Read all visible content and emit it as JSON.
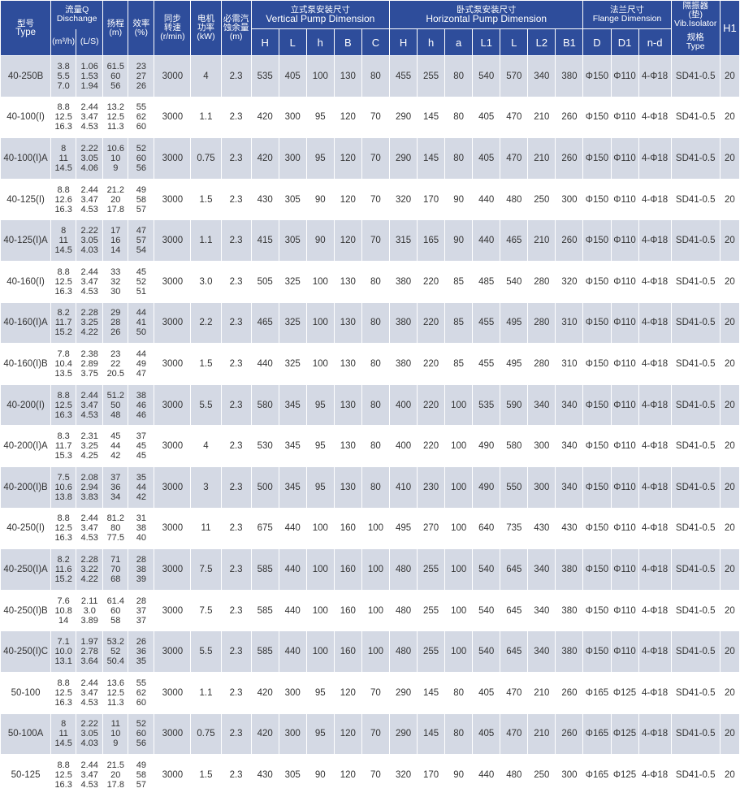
{
  "header": {
    "type_cn": "型号",
    "type_en": "Type",
    "flow_cn": "流量Q",
    "flow_en": "Dischange",
    "flow_unit_m3h": "(m³/h)",
    "flow_unit_ls": "(L/S)",
    "head_cn": "扬程",
    "head_unit": "(m)",
    "eff_cn": "效率",
    "eff_unit": "(%)",
    "speed_cn1": "同步",
    "speed_cn2": "转速",
    "speed_unit": "(r/min)",
    "power_cn1": "电机",
    "power_cn2": "功率",
    "power_unit": "(kW)",
    "npsh_cn1": "必需汽",
    "npsh_cn2": "蚀余量",
    "npsh_unit": "(m)",
    "vertical_cn": "立式泵安装尺寸",
    "vertical_en": "Vertical  Pump  Dimension",
    "horizontal_cn": "卧式泵安装尺寸",
    "horizontal_en": "Horizontal Pump Dimension",
    "flange_cn": "法兰尺寸",
    "flange_en": "Flange Dimension",
    "iso_cn1": "隔振器",
    "iso_cn2": "(垫)",
    "iso_en": "Vib.Isolator",
    "iso_sub_cn": "规格",
    "iso_sub_en": "Type",
    "h1": "H1",
    "v_cols": [
      "H",
      "L",
      "h",
      "B",
      "C"
    ],
    "h_cols": [
      "H",
      "h",
      "a",
      "L1",
      "L",
      "L2",
      "B1"
    ],
    "f_cols": [
      "D",
      "D1",
      "n-d"
    ]
  },
  "rows": [
    {
      "type": "40-250B",
      "q": [
        "3.8",
        "5.5",
        "7.0"
      ],
      "ls": [
        "1.06",
        "1.53",
        "1.94"
      ],
      "head": [
        "61.5",
        "60",
        "56"
      ],
      "eff": [
        "23",
        "27",
        "26"
      ],
      "speed": "3000",
      "power": "4",
      "npsh": "2.3",
      "v": [
        "535",
        "405",
        "100",
        "130",
        "80"
      ],
      "h": [
        "455",
        "255",
        "80",
        "540",
        "570",
        "340",
        "380"
      ],
      "f": [
        "Φ150",
        "Φ110",
        "4-Φ18"
      ],
      "iso": "SD41-0.5",
      "h1": "20"
    },
    {
      "type": "40-100(I)",
      "q": [
        "8.8",
        "12.5",
        "16.3"
      ],
      "ls": [
        "2.44",
        "3.47",
        "4.53"
      ],
      "head": [
        "13.2",
        "12.5",
        "11.3"
      ],
      "eff": [
        "55",
        "62",
        "60"
      ],
      "speed": "3000",
      "power": "1.1",
      "npsh": "2.3",
      "v": [
        "420",
        "300",
        "95",
        "120",
        "70"
      ],
      "h": [
        "290",
        "145",
        "80",
        "405",
        "470",
        "210",
        "260"
      ],
      "f": [
        "Φ150",
        "Φ110",
        "4-Φ18"
      ],
      "iso": "SD41-0.5",
      "h1": "20"
    },
    {
      "type": "40-100(I)A",
      "q": [
        "8",
        "11",
        "14.5"
      ],
      "ls": [
        "2.22",
        "3.05",
        "4.06"
      ],
      "head": [
        "10.6",
        "10",
        "9"
      ],
      "eff": [
        "52",
        "60",
        "56"
      ],
      "speed": "3000",
      "power": "0.75",
      "npsh": "2.3",
      "v": [
        "420",
        "300",
        "95",
        "120",
        "70"
      ],
      "h": [
        "290",
        "145",
        "80",
        "405",
        "470",
        "210",
        "260"
      ],
      "f": [
        "Φ150",
        "Φ110",
        "4-Φ18"
      ],
      "iso": "SD41-0.5",
      "h1": "20"
    },
    {
      "type": "40-125(I)",
      "q": [
        "8.8",
        "12.6",
        "16.3"
      ],
      "ls": [
        "2.44",
        "3.47",
        "4.53"
      ],
      "head": [
        "21.2",
        "20",
        "17.8"
      ],
      "eff": [
        "49",
        "58",
        "57"
      ],
      "speed": "3000",
      "power": "1.5",
      "npsh": "2.3",
      "v": [
        "430",
        "305",
        "90",
        "120",
        "70"
      ],
      "h": [
        "320",
        "170",
        "90",
        "440",
        "480",
        "250",
        "300"
      ],
      "f": [
        "Φ150",
        "Φ110",
        "4-Φ18"
      ],
      "iso": "SD41-0.5",
      "h1": "20"
    },
    {
      "type": "40-125(I)A",
      "q": [
        "8",
        "11",
        "14.5"
      ],
      "ls": [
        "2.22",
        "3.05",
        "4.03"
      ],
      "head": [
        "17",
        "16",
        "14"
      ],
      "eff": [
        "47",
        "57",
        "54"
      ],
      "speed": "3000",
      "power": "1.1",
      "npsh": "2.3",
      "v": [
        "415",
        "305",
        "90",
        "120",
        "70"
      ],
      "h": [
        "315",
        "165",
        "90",
        "440",
        "465",
        "210",
        "260"
      ],
      "f": [
        "Φ150",
        "Φ110",
        "4-Φ18"
      ],
      "iso": "SD41-0.5",
      "h1": "20"
    },
    {
      "type": "40-160(I)",
      "q": [
        "8.8",
        "12.5",
        "16.3"
      ],
      "ls": [
        "2.44",
        "3.47",
        "4.53"
      ],
      "head": [
        "33",
        "32",
        "30"
      ],
      "eff": [
        "45",
        "52",
        "51"
      ],
      "speed": "3000",
      "power": "3.0",
      "npsh": "2.3",
      "v": [
        "505",
        "325",
        "100",
        "130",
        "80"
      ],
      "h": [
        "380",
        "220",
        "85",
        "485",
        "540",
        "280",
        "320"
      ],
      "f": [
        "Φ150",
        "Φ110",
        "4-Φ18"
      ],
      "iso": "SD41-0.5",
      "h1": "20"
    },
    {
      "type": "40-160(I)A",
      "q": [
        "8.2",
        "11.7",
        "15.2"
      ],
      "ls": [
        "2.28",
        "3.25",
        "4.22"
      ],
      "head": [
        "29",
        "28",
        "26"
      ],
      "eff": [
        "44",
        "41",
        "50"
      ],
      "speed": "3000",
      "power": "2.2",
      "npsh": "2.3",
      "v": [
        "465",
        "325",
        "100",
        "130",
        "80"
      ],
      "h": [
        "380",
        "220",
        "85",
        "455",
        "495",
        "280",
        "310"
      ],
      "f": [
        "Φ150",
        "Φ110",
        "4-Φ18"
      ],
      "iso": "SD41-0.5",
      "h1": "20"
    },
    {
      "type": "40-160(I)B",
      "q": [
        "7.8",
        "10.4",
        "13.5"
      ],
      "ls": [
        "2.38",
        "2.89",
        "3.75"
      ],
      "head": [
        "23",
        "22",
        "20.5"
      ],
      "eff": [
        "44",
        "49",
        "47"
      ],
      "speed": "3000",
      "power": "1.5",
      "npsh": "2.3",
      "v": [
        "440",
        "325",
        "100",
        "130",
        "80"
      ],
      "h": [
        "380",
        "220",
        "85",
        "455",
        "495",
        "280",
        "310"
      ],
      "f": [
        "Φ150",
        "Φ110",
        "4-Φ18"
      ],
      "iso": "SD41-0.5",
      "h1": "20"
    },
    {
      "type": "40-200(I)",
      "q": [
        "8.8",
        "12.5",
        "16.3"
      ],
      "ls": [
        "2.44",
        "3.47",
        "4.53"
      ],
      "head": [
        "51.2",
        "50",
        "48"
      ],
      "eff": [
        "38",
        "46",
        "46"
      ],
      "speed": "3000",
      "power": "5.5",
      "npsh": "2.3",
      "v": [
        "580",
        "345",
        "95",
        "130",
        "80"
      ],
      "h": [
        "400",
        "220",
        "100",
        "535",
        "590",
        "340",
        "340"
      ],
      "f": [
        "Φ150",
        "Φ110",
        "4-Φ18"
      ],
      "iso": "SD41-0.5",
      "h1": "20"
    },
    {
      "type": "40-200(I)A",
      "q": [
        "8.3",
        "11.7",
        "15.3"
      ],
      "ls": [
        "2.31",
        "3.25",
        "4.25"
      ],
      "head": [
        "45",
        "44",
        "42"
      ],
      "eff": [
        "37",
        "45",
        "45"
      ],
      "speed": "3000",
      "power": "4",
      "npsh": "2.3",
      "v": [
        "530",
        "345",
        "95",
        "130",
        "80"
      ],
      "h": [
        "400",
        "220",
        "100",
        "490",
        "580",
        "300",
        "340"
      ],
      "f": [
        "Φ150",
        "Φ110",
        "4-Φ18"
      ],
      "iso": "SD41-0.5",
      "h1": "20"
    },
    {
      "type": "40-200(I)B",
      "q": [
        "7.5",
        "10.6",
        "13.8"
      ],
      "ls": [
        "2.08",
        "2.94",
        "3.83"
      ],
      "head": [
        "37",
        "36",
        "34"
      ],
      "eff": [
        "35",
        "44",
        "42"
      ],
      "speed": "3000",
      "power": "3",
      "npsh": "2.3",
      "v": [
        "500",
        "345",
        "95",
        "130",
        "80"
      ],
      "h": [
        "410",
        "230",
        "100",
        "490",
        "550",
        "300",
        "340"
      ],
      "f": [
        "Φ150",
        "Φ110",
        "4-Φ18"
      ],
      "iso": "SD41-0.5",
      "h1": "20"
    },
    {
      "type": "40-250(I)",
      "q": [
        "8.8",
        "12.5",
        "16.3"
      ],
      "ls": [
        "2.44",
        "3.47",
        "4.53"
      ],
      "head": [
        "81.2",
        "80",
        "77.5"
      ],
      "eff": [
        "31",
        "38",
        "40"
      ],
      "speed": "3000",
      "power": "11",
      "npsh": "2.3",
      "v": [
        "675",
        "440",
        "100",
        "160",
        "100"
      ],
      "h": [
        "495",
        "270",
        "100",
        "640",
        "735",
        "430",
        "430"
      ],
      "f": [
        "Φ150",
        "Φ110",
        "4-Φ18"
      ],
      "iso": "SD41-0.5",
      "h1": "20"
    },
    {
      "type": "40-250(I)A",
      "q": [
        "8.2",
        "11.6",
        "15.2"
      ],
      "ls": [
        "2.28",
        "3.22",
        "4.22"
      ],
      "head": [
        "71",
        "70",
        "68"
      ],
      "eff": [
        "28",
        "38",
        "39"
      ],
      "speed": "3000",
      "power": "7.5",
      "npsh": "2.3",
      "v": [
        "585",
        "440",
        "100",
        "160",
        "100"
      ],
      "h": [
        "480",
        "255",
        "100",
        "540",
        "645",
        "340",
        "380"
      ],
      "f": [
        "Φ150",
        "Φ110",
        "4-Φ18"
      ],
      "iso": "SD41-0.5",
      "h1": "20"
    },
    {
      "type": "40-250(I)B",
      "q": [
        "7.6",
        "10.8",
        "14"
      ],
      "ls": [
        "2.11",
        "3.0",
        "3.89"
      ],
      "head": [
        "61.4",
        "60",
        "58"
      ],
      "eff": [
        "28",
        "37",
        "37"
      ],
      "speed": "3000",
      "power": "7.5",
      "npsh": "2.3",
      "v": [
        "585",
        "440",
        "100",
        "160",
        "100"
      ],
      "h": [
        "480",
        "255",
        "100",
        "540",
        "645",
        "340",
        "380"
      ],
      "f": [
        "Φ150",
        "Φ110",
        "4-Φ18"
      ],
      "iso": "SD41-0.5",
      "h1": "20"
    },
    {
      "type": "40-250(I)C",
      "q": [
        "7.1",
        "10.0",
        "13.1"
      ],
      "ls": [
        "1.97",
        "2.78",
        "3.64"
      ],
      "head": [
        "53.2",
        "52",
        "50.4"
      ],
      "eff": [
        "26",
        "36",
        "35"
      ],
      "speed": "3000",
      "power": "5.5",
      "npsh": "2.3",
      "v": [
        "585",
        "440",
        "100",
        "160",
        "100"
      ],
      "h": [
        "480",
        "255",
        "100",
        "540",
        "645",
        "340",
        "380"
      ],
      "f": [
        "Φ150",
        "Φ110",
        "4-Φ18"
      ],
      "iso": "SD41-0.5",
      "h1": "20"
    },
    {
      "type": "50-100",
      "q": [
        "8.8",
        "12.5",
        "16.3"
      ],
      "ls": [
        "2.44",
        "3.47",
        "4.53"
      ],
      "head": [
        "13.6",
        "12.5",
        "11.3"
      ],
      "eff": [
        "55",
        "62",
        "60"
      ],
      "speed": "3000",
      "power": "1.1",
      "npsh": "2.3",
      "v": [
        "420",
        "300",
        "95",
        "120",
        "70"
      ],
      "h": [
        "290",
        "145",
        "80",
        "405",
        "470",
        "210",
        "260"
      ],
      "f": [
        "Φ165",
        "Φ125",
        "4-Φ18"
      ],
      "iso": "SD41-0.5",
      "h1": "20"
    },
    {
      "type": "50-100A",
      "q": [
        "8",
        "11",
        "14.5"
      ],
      "ls": [
        "2.22",
        "3.05",
        "4.03"
      ],
      "head": [
        "11",
        "10",
        "9"
      ],
      "eff": [
        "52",
        "60",
        "56"
      ],
      "speed": "3000",
      "power": "0.75",
      "npsh": "2.3",
      "v": [
        "420",
        "300",
        "95",
        "120",
        "70"
      ],
      "h": [
        "290",
        "145",
        "80",
        "405",
        "470",
        "210",
        "260"
      ],
      "f": [
        "Φ165",
        "Φ125",
        "4-Φ18"
      ],
      "iso": "SD41-0.5",
      "h1": "20"
    },
    {
      "type": "50-125",
      "q": [
        "8.8",
        "12.5",
        "16.3"
      ],
      "ls": [
        "2.44",
        "3.47",
        "4.53"
      ],
      "head": [
        "21.5",
        "20",
        "17.8"
      ],
      "eff": [
        "49",
        "58",
        "57"
      ],
      "speed": "3000",
      "power": "1.5",
      "npsh": "2.3",
      "v": [
        "430",
        "305",
        "90",
        "120",
        "70"
      ],
      "h": [
        "320",
        "170",
        "90",
        "440",
        "480",
        "250",
        "300"
      ],
      "f": [
        "Φ165",
        "Φ125",
        "4-Φ18"
      ],
      "iso": "SD41-0.5",
      "h1": "20"
    }
  ]
}
